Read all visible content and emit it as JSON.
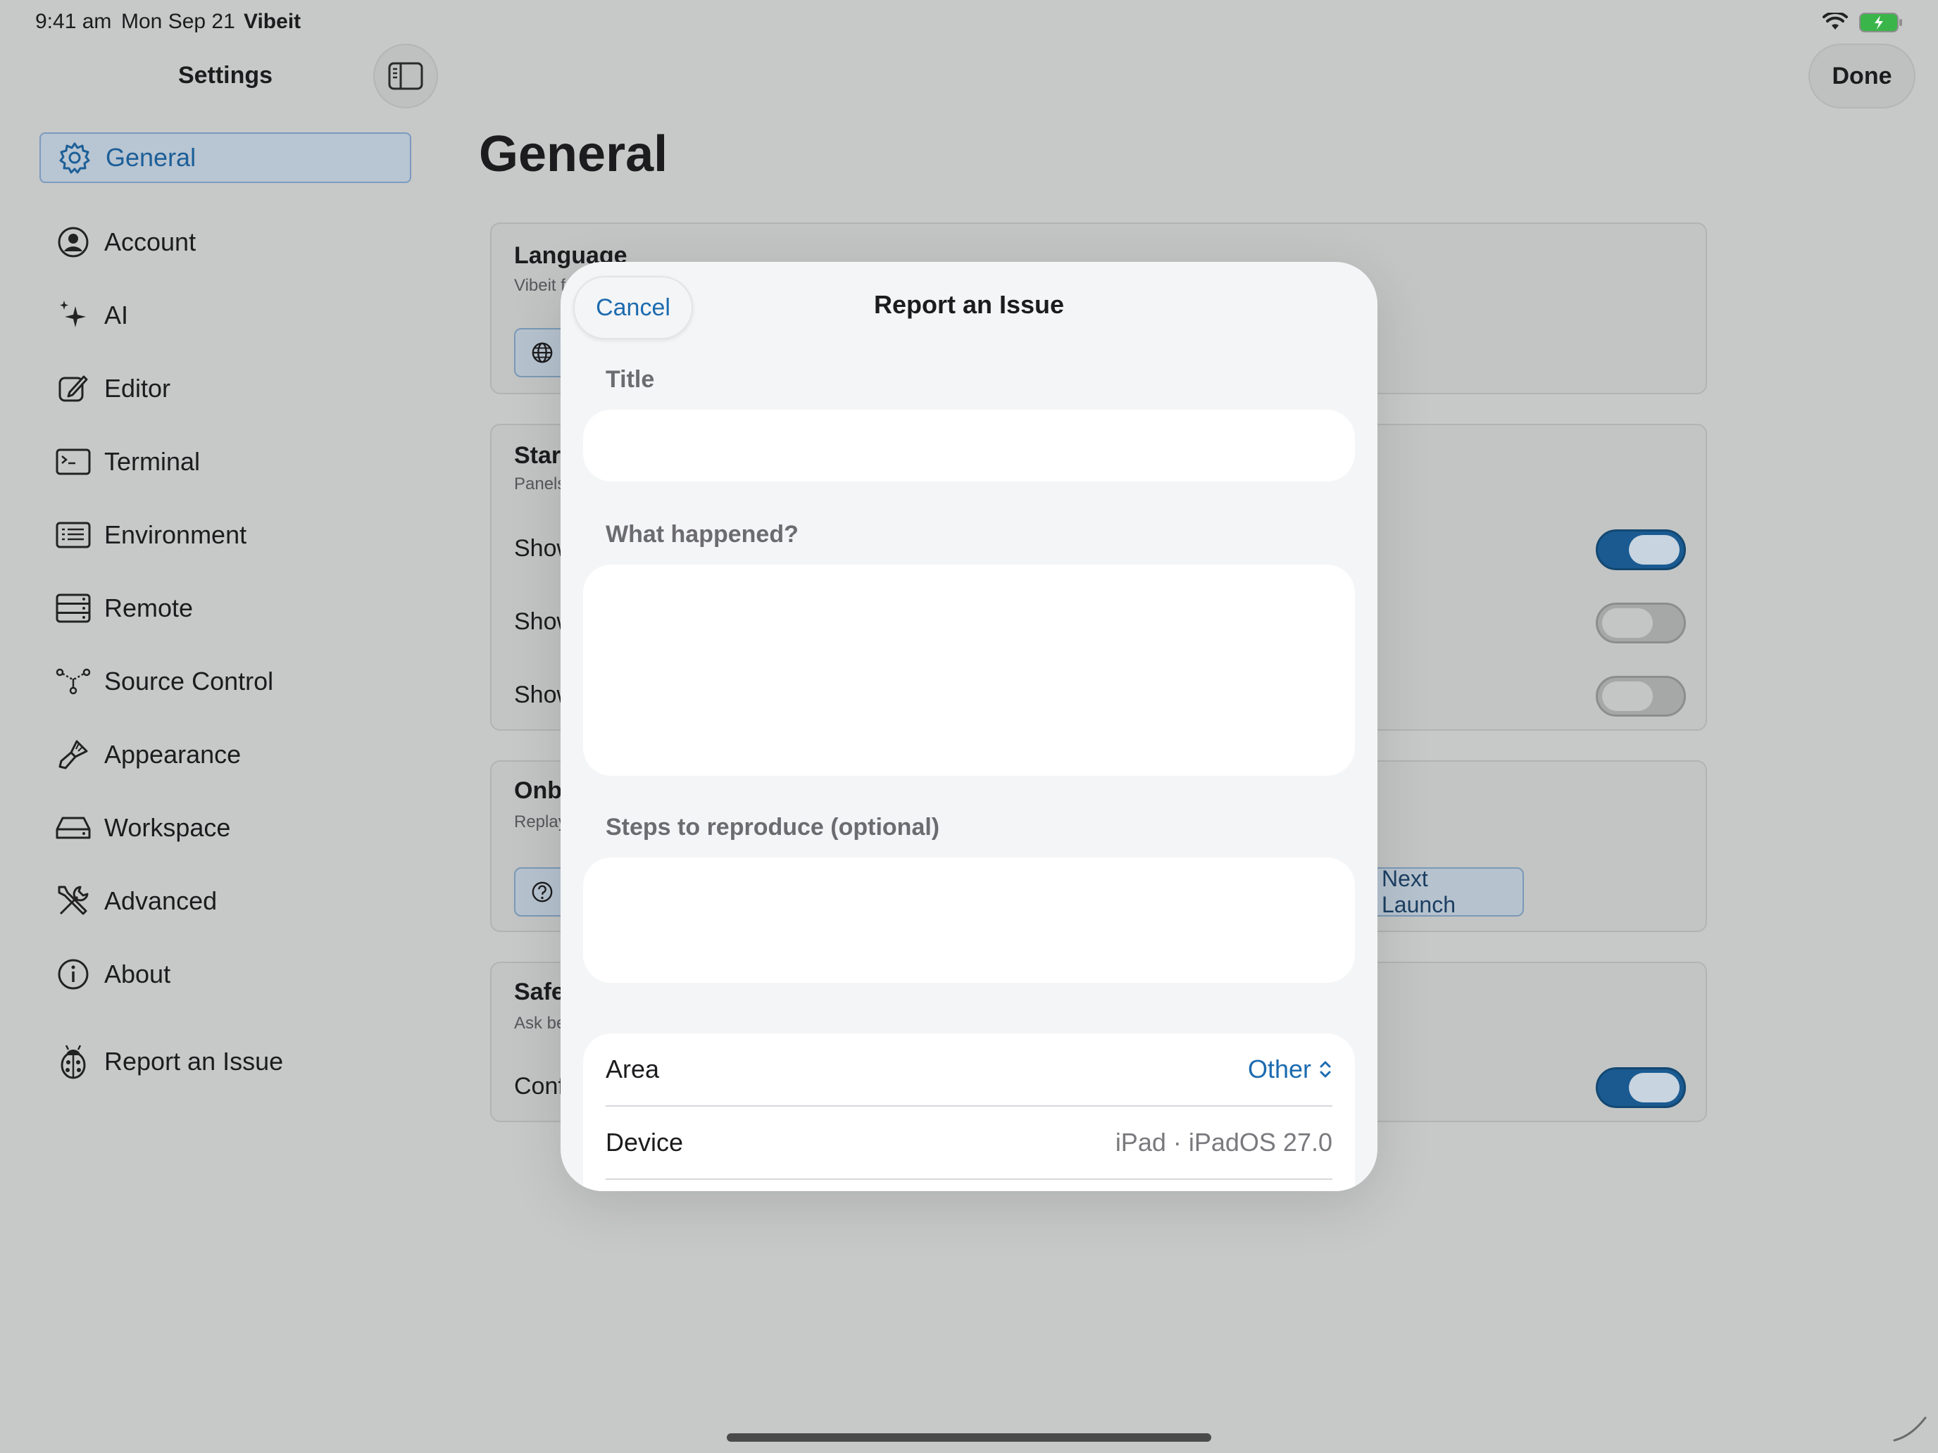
{
  "status": {
    "time": "9:41 am",
    "date": "Mon Sep 21",
    "app": "Vibeit"
  },
  "sidebar": {
    "title": "Settings",
    "items": [
      {
        "label": "General",
        "icon": "gear-icon"
      },
      {
        "label": "Account",
        "icon": "person-circle-icon"
      },
      {
        "label": "AI",
        "icon": "sparkles-icon"
      },
      {
        "label": "Editor",
        "icon": "edit-icon"
      },
      {
        "label": "Terminal",
        "icon": "terminal-icon"
      },
      {
        "label": "Environment",
        "icon": "list-icon"
      },
      {
        "label": "Remote",
        "icon": "server-icon"
      },
      {
        "label": "Source Control",
        "icon": "branch-icon"
      },
      {
        "label": "Appearance",
        "icon": "paintbrush-icon"
      },
      {
        "label": "Workspace",
        "icon": "drive-icon"
      },
      {
        "label": "Advanced",
        "icon": "wrench-screwdriver-icon"
      },
      {
        "label": "About",
        "icon": "info-icon"
      },
      {
        "label": "Report an Issue",
        "icon": "ladybug-icon"
      }
    ]
  },
  "main": {
    "title": "General",
    "done_label": "Done",
    "cards": {
      "language": {
        "title": "Language",
        "subtitle": "Vibeit f"
      },
      "startup": {
        "title": "Star",
        "subtitle": "Panels",
        "rows": [
          "Show",
          "Show",
          "Show"
        ],
        "toggles": [
          true,
          false,
          false
        ]
      },
      "onboarding": {
        "title": "Onb",
        "subtitle": "Replay",
        "chip": "Next Launch"
      },
      "safety": {
        "title": "Safe",
        "subtitle": "Ask be",
        "row": "Conf",
        "toggle": true
      }
    }
  },
  "modal": {
    "title": "Report an Issue",
    "cancel_label": "Cancel",
    "fields": {
      "title_label": "Title",
      "title_value": "",
      "what_label": "What happened?",
      "what_value": "",
      "steps_label": "Steps to reproduce (optional)",
      "steps_value": ""
    },
    "info": {
      "area_label": "Area",
      "area_value": "Other",
      "device_label": "Device",
      "device_value": "iPad · iPadOS 27.0"
    }
  },
  "colors": {
    "accent": "#1c6bb0",
    "toggle_on": "#1a5a91",
    "backdrop": "#c7c9c8"
  }
}
